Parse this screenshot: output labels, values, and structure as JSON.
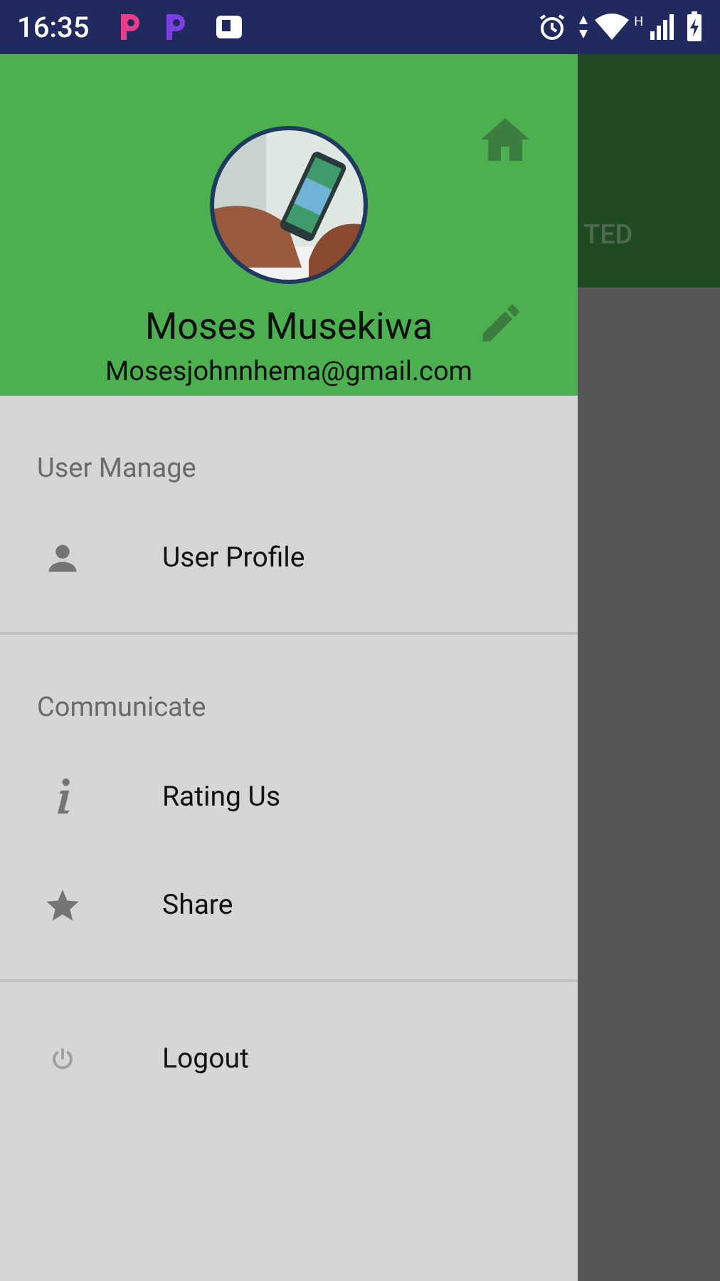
{
  "status_bar": {
    "time": "16:35",
    "network_type": "H"
  },
  "background": {
    "header_text": "TED"
  },
  "drawer": {
    "user": {
      "name": "Moses Musekiwa",
      "email": "Mosesjohnnhema@gmail.com"
    },
    "sections": [
      {
        "title": "User Manage",
        "items": [
          {
            "label": "User Profile"
          }
        ]
      },
      {
        "title": "Communicate",
        "items": [
          {
            "label": "Rating Us"
          },
          {
            "label": "Share"
          }
        ]
      },
      {
        "items": [
          {
            "label": "Logout"
          }
        ]
      }
    ]
  }
}
